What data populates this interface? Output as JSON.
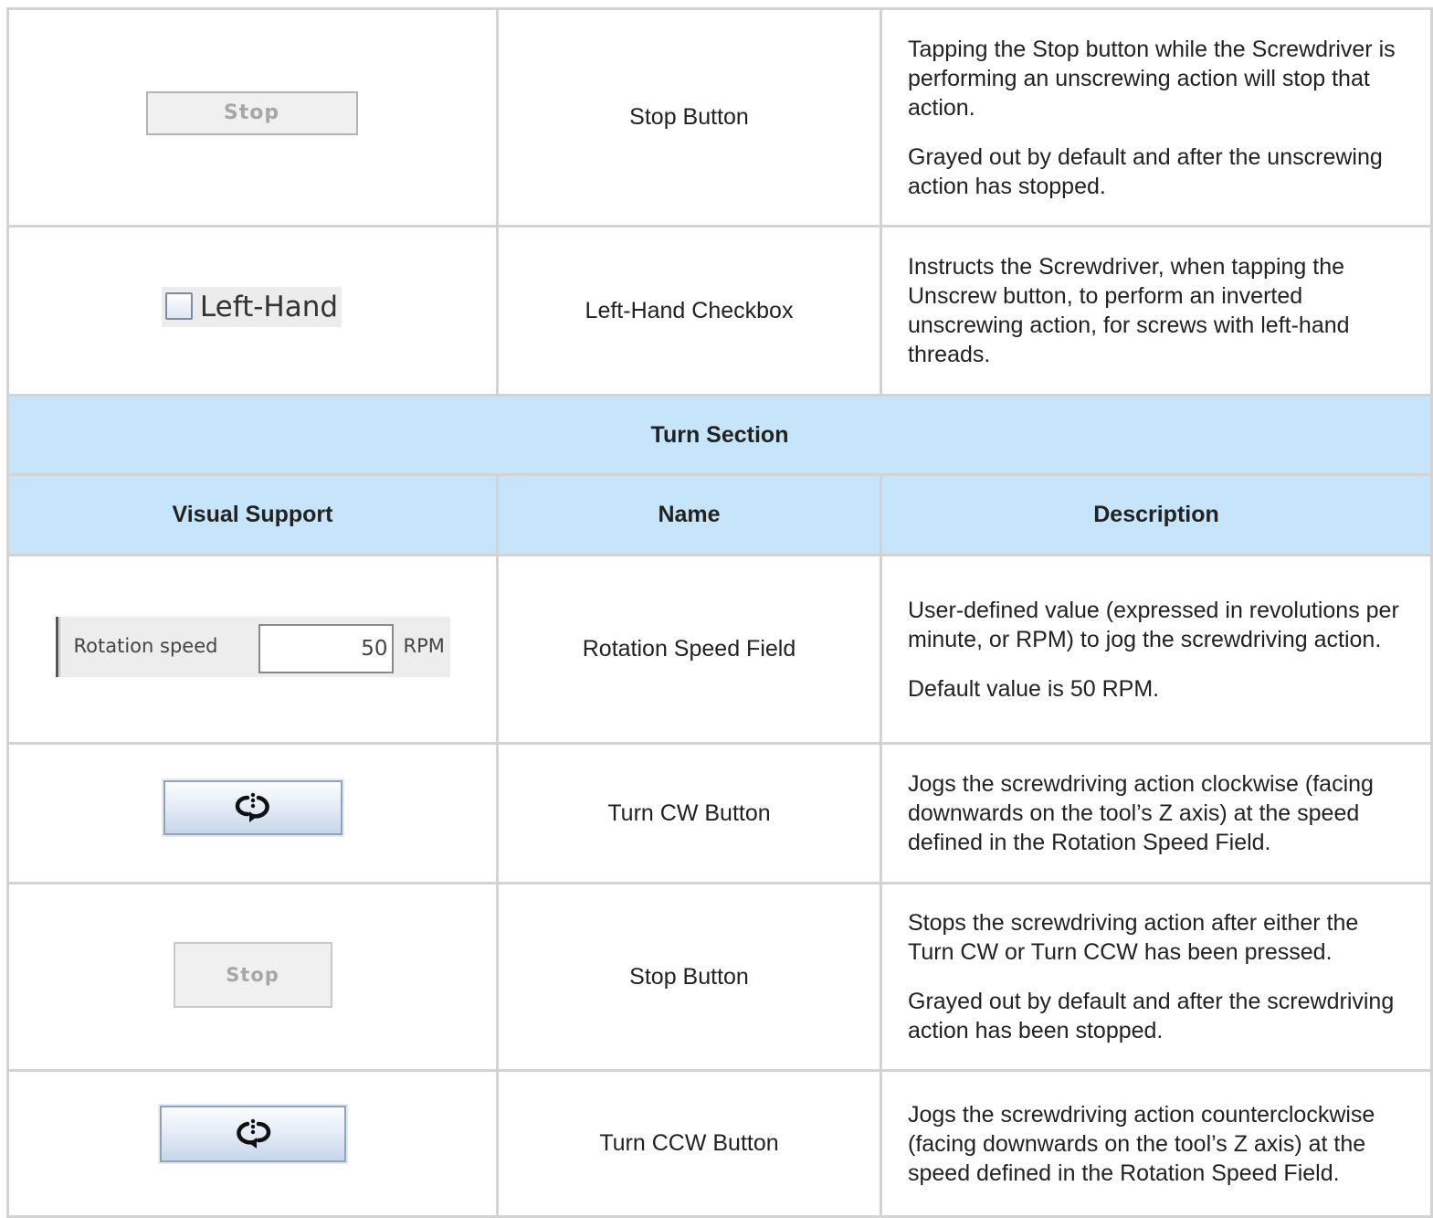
{
  "rows_top": [
    {
      "visual": {
        "type": "stop-button",
        "label": "Stop"
      },
      "name": "Stop Button",
      "desc": [
        "Tapping the Stop button while the Screwdriver is performing an unscrewing action will stop that action.",
        "Grayed out by default and after the unscrewing action has stopped."
      ]
    },
    {
      "visual": {
        "type": "checkbox",
        "label": "Left-Hand"
      },
      "name": "Left-Hand Checkbox",
      "desc": [
        "Instructs the Screwdriver, when tapping the Unscrew button, to perform an inverted unscrewing action, for screws with left-hand threads."
      ]
    }
  ],
  "section": {
    "title": "Turn Section"
  },
  "column_headers": {
    "visual": "Visual Support",
    "name": "Name",
    "desc": "Description"
  },
  "rows_turn": [
    {
      "visual": {
        "type": "rotation-field",
        "label": "Rotation speed",
        "value": "50",
        "unit": "RPM"
      },
      "name": "Rotation Speed Field",
      "desc": [
        "User-defined value (expressed in revolutions per minute, or RPM) to jog the screwdriving action.",
        "Default value is 50 RPM."
      ]
    },
    {
      "visual": {
        "type": "turn-cw-button",
        "icon": "rotate-cw-icon"
      },
      "name": "Turn CW Button",
      "desc": [
        "Jogs the screwdriving action clockwise (facing downwards on the tool’s Z axis) at the speed defined in the Rotation Speed Field."
      ]
    },
    {
      "visual": {
        "type": "stop-button",
        "label": "Stop"
      },
      "name": "Stop Button",
      "desc": [
        "Stops the screwdriving action after either the Turn CW or Turn CCW has been pressed.",
        "Grayed out by default and after the screwdriving action has been stopped."
      ]
    },
    {
      "visual": {
        "type": "turn-ccw-button",
        "icon": "rotate-ccw-icon"
      },
      "name": "Turn CCW Button",
      "desc": [
        "Jogs the screwdriving action counterclockwise (facing downwards on the tool’s Z axis) at the speed defined in the Rotation Speed Field."
      ]
    }
  ],
  "colors": {
    "header_bg": "#c6e5fb",
    "grid": "#d3d3d3",
    "button_border": "#8fa3bd"
  }
}
